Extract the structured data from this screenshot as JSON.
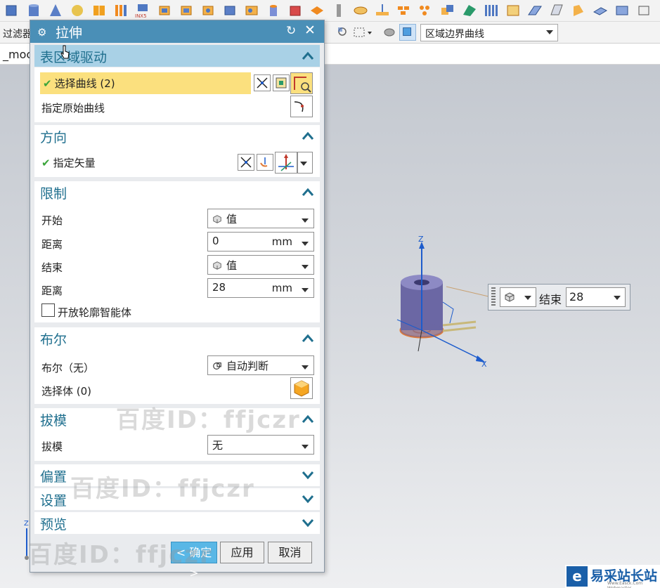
{
  "toolbar": {
    "icons": [
      "block-icon",
      "cylinder-icon",
      "cone-icon",
      "sphere-icon",
      "book-icon",
      "rib-icon",
      "nx5-icon",
      "extrude-icon",
      "revolve-icon",
      "hole-icon",
      "boss-icon",
      "pocket-icon",
      "cylinder-tank-icon",
      "box-red-icon",
      "pad-icon",
      "thread-icon",
      "sketch-icon",
      "plane-icon",
      "array-icon",
      "dots-icon",
      "unite-icon",
      "shape-icon",
      "bars-icon",
      "frame-icon",
      "fold-icon",
      "sheet-icon",
      "bend-icon",
      "plate-icon",
      "box-icon",
      "cube-icon"
    ]
  },
  "selection_bar": {
    "filter_label": "过滤器",
    "curve_rule": "区域边界曲线"
  },
  "tab": {
    "model_tab": "_moc"
  },
  "dialog": {
    "title": "拉伸",
    "sections": {
      "region": {
        "title": "表区域驱动",
        "select_curve": "选择曲线 (2)",
        "original_curve": "指定原始曲线"
      },
      "direction": {
        "title": "方向",
        "vector": "指定矢量"
      },
      "limits": {
        "title": "限制",
        "start_label": "开始",
        "start_value": "值",
        "distance1_label": "距离",
        "distance1_value": "0",
        "unit1": "mm",
        "end_label": "结束",
        "end_value": "值",
        "distance2_label": "距离",
        "distance2_value": "28",
        "unit2": "mm",
        "open_profile": "开放轮廓智能体"
      },
      "boolean": {
        "title": "布尔",
        "label": "布尔（无）",
        "value": "自动判断",
        "select_body": "选择体 (0)"
      },
      "draft": {
        "title": "拔模",
        "label": "拔模",
        "value": "无"
      },
      "offset": {
        "title": "偏置"
      },
      "settings": {
        "title": "设置"
      },
      "preview": {
        "title": "预览"
      }
    },
    "buttons": {
      "ok": "< 确定 >",
      "apply": "应用",
      "cancel": "取消"
    }
  },
  "onscreen": {
    "label": "结束",
    "value": "28"
  },
  "axes": {
    "z": "Z",
    "x": "X",
    "triad_z": "Z"
  },
  "watermark": "百度ID：ffjczr",
  "logo": {
    "text": "易采站长站",
    "sub": "Www.Easck.Com Webmaster"
  },
  "colors": {
    "title_bar": "#4a8fb7",
    "section_title": "#1f6f8e",
    "highlight": "#fbe07e",
    "ok_button": "#59b7e6"
  }
}
